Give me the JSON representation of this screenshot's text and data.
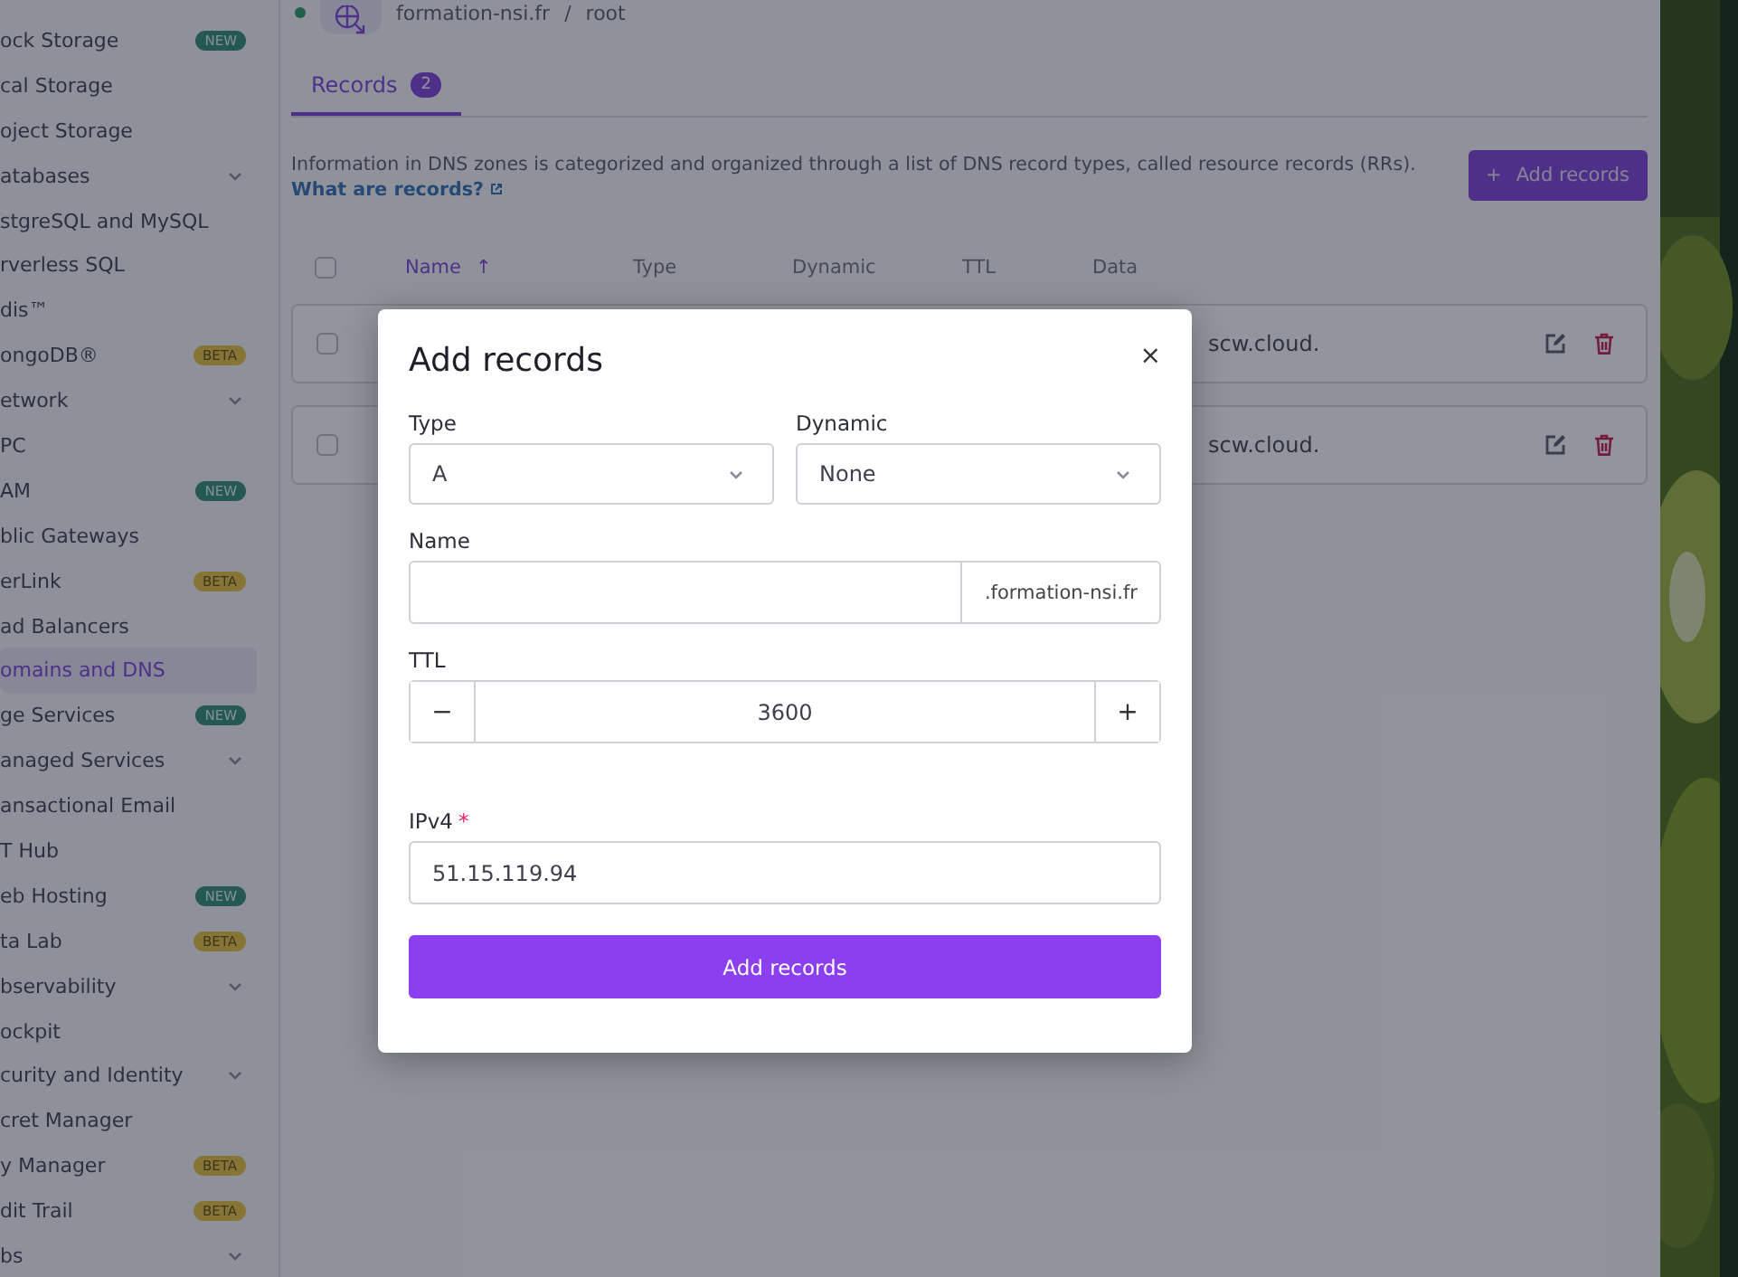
{
  "sidebar": {
    "items": [
      {
        "kind": "link",
        "label": "ock Storage",
        "selected": false,
        "badge": {
          "text": "NEW",
          "kind": "new"
        }
      },
      {
        "kind": "link",
        "label": "cal Storage",
        "selected": false
      },
      {
        "kind": "link",
        "label": "oject Storage",
        "selected": false
      },
      {
        "kind": "group",
        "label": "atabases",
        "selected": false
      },
      {
        "kind": "link",
        "label": "stgreSQL and MySQL",
        "selected": false
      },
      {
        "kind": "link",
        "label": "rverless SQL",
        "selected": false
      },
      {
        "kind": "link",
        "label": "dis™",
        "selected": false
      },
      {
        "kind": "link",
        "label": "ongoDB®",
        "selected": false,
        "badge": {
          "text": "BETA",
          "kind": "beta"
        }
      },
      {
        "kind": "group",
        "label": "etwork",
        "selected": false
      },
      {
        "kind": "link",
        "label": "PC",
        "selected": false
      },
      {
        "kind": "link",
        "label": "AM",
        "selected": false,
        "badge": {
          "text": "NEW",
          "kind": "new"
        }
      },
      {
        "kind": "link",
        "label": "blic Gateways",
        "selected": false
      },
      {
        "kind": "link",
        "label": "erLink",
        "selected": false,
        "badge": {
          "text": "BETA",
          "kind": "beta"
        }
      },
      {
        "kind": "link",
        "label": "ad Balancers",
        "selected": false
      },
      {
        "kind": "link",
        "label": "omains and DNS",
        "selected": true
      },
      {
        "kind": "link",
        "label": "ge Services",
        "selected": false,
        "badge": {
          "text": "NEW",
          "kind": "new"
        }
      },
      {
        "kind": "group",
        "label": "anaged Services",
        "selected": false
      },
      {
        "kind": "link",
        "label": "ansactional Email",
        "selected": false
      },
      {
        "kind": "link",
        "label": "T Hub",
        "selected": false
      },
      {
        "kind": "link",
        "label": "eb Hosting",
        "selected": false,
        "badge": {
          "text": "NEW",
          "kind": "new"
        }
      },
      {
        "kind": "link",
        "label": "ta Lab",
        "selected": false,
        "badge": {
          "text": "BETA",
          "kind": "beta"
        }
      },
      {
        "kind": "group",
        "label": "bservability",
        "selected": false
      },
      {
        "kind": "link",
        "label": "ockpit",
        "selected": false
      },
      {
        "kind": "group",
        "label": "curity and Identity",
        "selected": false
      },
      {
        "kind": "link",
        "label": "cret Manager",
        "selected": false
      },
      {
        "kind": "link",
        "label": "y Manager",
        "selected": false,
        "badge": {
          "text": "BETA",
          "kind": "beta"
        }
      },
      {
        "kind": "link",
        "label": "dit Trail",
        "selected": false,
        "badge": {
          "text": "BETA",
          "kind": "beta"
        }
      },
      {
        "kind": "group",
        "label": "bs",
        "selected": false
      }
    ]
  },
  "breadcrumb": {
    "items": [
      "formation-nsi.fr",
      "/",
      "root"
    ]
  },
  "tabs": [
    {
      "label": "Records",
      "count": "2",
      "selected": true
    }
  ],
  "description": {
    "text": "Information in DNS zones is categorized and organized through a list of DNS record types, called resource records (RRs).",
    "link": "What are records?"
  },
  "add_button": {
    "icon": "+",
    "label": "Add records"
  },
  "table": {
    "select_all_checked": false,
    "columns": [
      "Name",
      "Type",
      "Dynamic",
      "TTL",
      "Data"
    ],
    "sort_icon": "↑",
    "rows": [
      {
        "checked": false,
        "data": "scw.cloud."
      },
      {
        "checked": false,
        "data": "scw.cloud."
      }
    ]
  },
  "modal": {
    "title": "Add records",
    "close": "×",
    "type": {
      "label": "Type",
      "value": "A"
    },
    "dynamic": {
      "label": "Dynamic",
      "value": "None"
    },
    "name": {
      "label": "Name",
      "suffix": ".formation-nsi.fr"
    },
    "ttl": {
      "label": "TTL",
      "value": "3600",
      "minus": "−",
      "plus": "+"
    },
    "ipv4": {
      "label": "IPv4",
      "required_mark": "*",
      "value": "51.15.119.94"
    },
    "submit": "Add records"
  }
}
